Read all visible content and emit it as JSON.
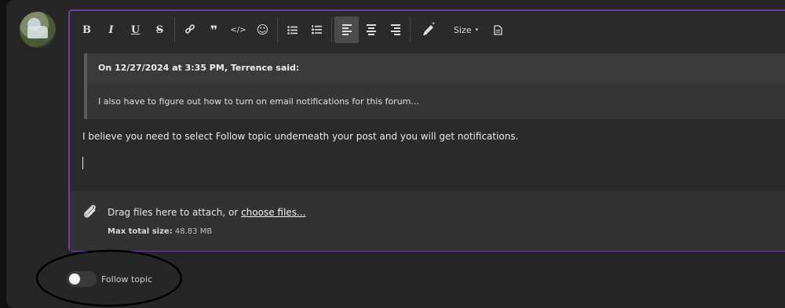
{
  "toolbar": {
    "buttons": [
      {
        "name": "bold",
        "label": "B"
      },
      {
        "name": "italic",
        "label": "I"
      },
      {
        "name": "underline",
        "label": "U"
      },
      {
        "name": "strikethrough",
        "label": "S"
      },
      {
        "name": "link",
        "icon": "link-icon"
      },
      {
        "name": "quote",
        "label": "❞",
        "icon": "quote-icon"
      },
      {
        "name": "code",
        "label": "</>",
        "icon": "code-icon"
      },
      {
        "name": "emoji",
        "label": "☺",
        "icon": "emoji-icon"
      },
      {
        "name": "bulleted-list",
        "icon": "bulleted-list-icon"
      },
      {
        "name": "numbered-list",
        "icon": "numbered-list-icon"
      },
      {
        "name": "align-left",
        "icon": "align-left-icon",
        "active": true
      },
      {
        "name": "align-center",
        "icon": "align-center-icon"
      },
      {
        "name": "align-right",
        "icon": "align-right-icon"
      },
      {
        "name": "text-color",
        "icon": "brush-icon"
      },
      {
        "name": "source",
        "icon": "document-icon"
      }
    ],
    "size_label": "Size",
    "size_caret": "▾"
  },
  "quote": {
    "header": "On 12/27/2024 at 3:35 PM, Terrence said:",
    "body": "I also have to figure out how to turn on email notifications for this forum..."
  },
  "reply": {
    "text": "I believe you need to select Follow topic underneath your post and you will get notifications."
  },
  "attach": {
    "prompt": "Drag files here to attach, or",
    "link": "choose files...",
    "max_label": "Max total size:",
    "max_value": "48.83 MB"
  },
  "follow": {
    "label": "Follow topic",
    "enabled": false
  },
  "colors": {
    "accent_border": "#6f3fa3",
    "panel": "#262626",
    "background": "#111111"
  }
}
